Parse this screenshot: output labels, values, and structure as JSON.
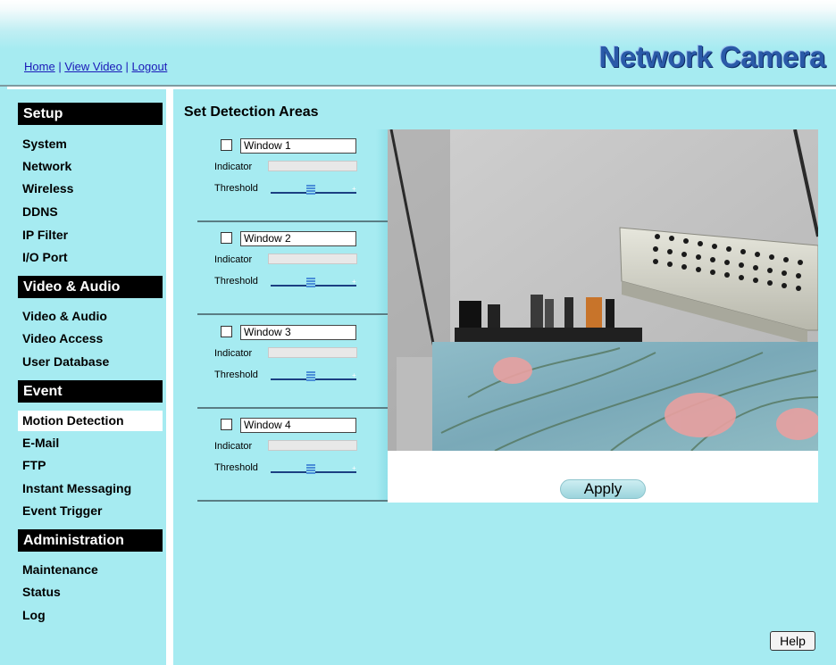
{
  "header": {
    "links": [
      "Home",
      "View Video",
      "Logout"
    ],
    "separator": "|",
    "brand": "Network Camera"
  },
  "sidebar": {
    "sections": [
      {
        "title": "Setup",
        "items": [
          "System",
          "Network",
          "Wireless",
          "DDNS",
          "IP Filter",
          "I/O Port"
        ]
      },
      {
        "title": "Video & Audio",
        "items": [
          "Video & Audio",
          "Video Access",
          "User Database"
        ]
      },
      {
        "title": "Event",
        "items": [
          "Motion Detection",
          "E-Mail",
          "FTP",
          "Instant Messaging",
          "Event Trigger"
        ]
      },
      {
        "title": "Administration",
        "items": [
          "Maintenance",
          "Status",
          "Log"
        ]
      }
    ],
    "active_item": "Motion Detection"
  },
  "main": {
    "title": "Set Detection Areas",
    "windows": [
      {
        "name": "Window 1",
        "checked": false,
        "indicator_label": "Indicator",
        "threshold_label": "Threshold"
      },
      {
        "name": "Window 2",
        "checked": false,
        "indicator_label": "Indicator",
        "threshold_label": "Threshold"
      },
      {
        "name": "Window 3",
        "checked": false,
        "indicator_label": "Indicator",
        "threshold_label": "Threshold"
      },
      {
        "name": "Window 4",
        "checked": false,
        "indicator_label": "Indicator",
        "threshold_label": "Threshold"
      }
    ],
    "apply_label": "Apply",
    "help_label": "Help"
  },
  "colors": {
    "background": "#a6ebf1",
    "brand": "#2a5aa8",
    "link": "#1a1ab8",
    "section_header": "#000000"
  }
}
